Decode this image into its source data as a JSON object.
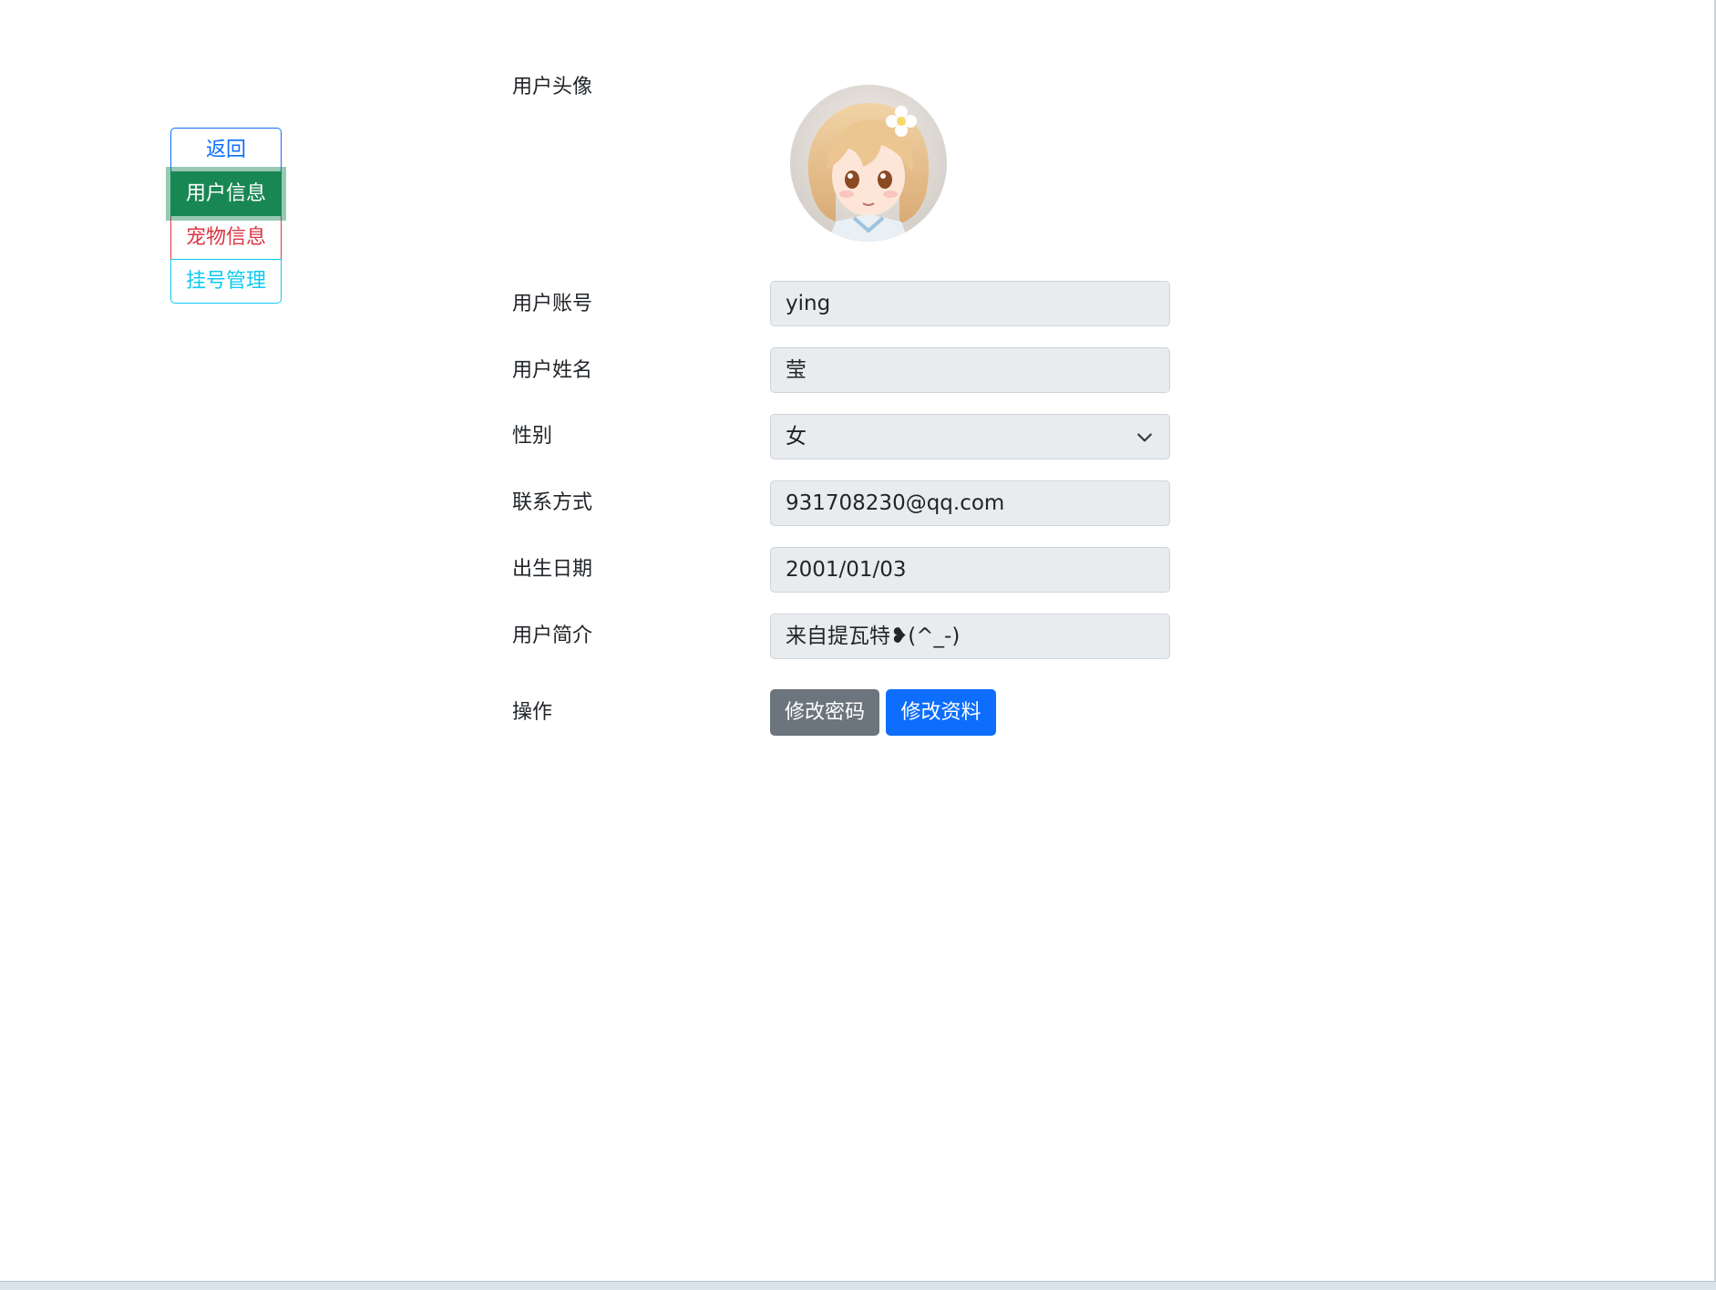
{
  "nav": {
    "back": "返回",
    "user_info": "用户信息",
    "pet_info": "宠物信息",
    "registration": "挂号管理"
  },
  "form": {
    "avatar_label": "用户头像",
    "account_label": "用户账号",
    "account_value": "ying",
    "name_label": "用户姓名",
    "name_value": "莹",
    "gender_label": "性别",
    "gender_value": "女",
    "contact_label": "联系方式",
    "contact_value": "931708230@qq.com",
    "birth_label": "出生日期",
    "birth_value": "2001/01/03",
    "bio_label": "用户简介",
    "bio_value": "来自提瓦特❥(^_-)",
    "actions_label": "操作"
  },
  "actions": {
    "change_password": "修改密码",
    "edit_profile": "修改资料"
  },
  "colors": {
    "primary": "#0d6efd",
    "success": "#198754",
    "danger": "#dc3545",
    "info": "#0dcaf0",
    "secondary": "#6c757d",
    "field_bg": "#e9ecef"
  },
  "icons": {
    "select": "chevron-down-icon"
  }
}
